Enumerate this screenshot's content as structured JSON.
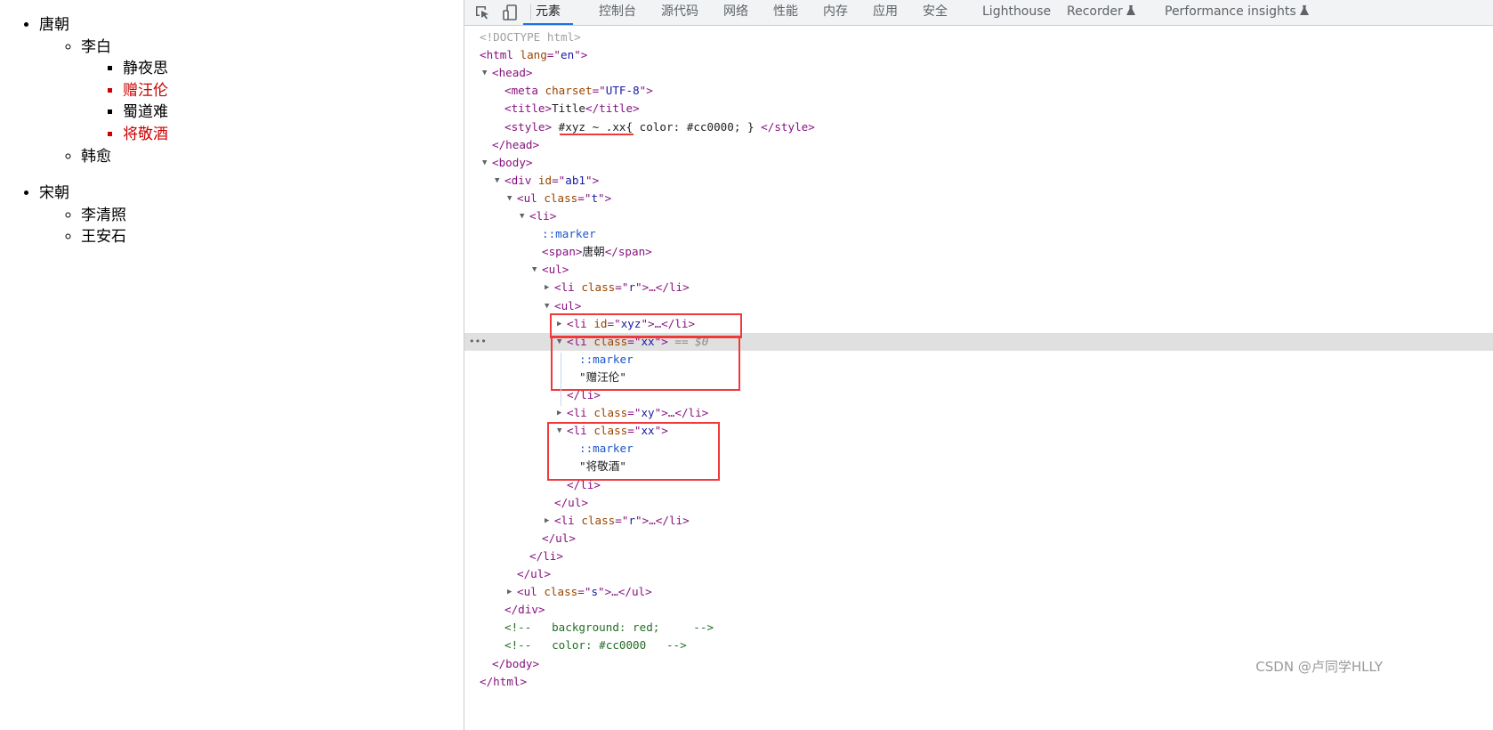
{
  "page": {
    "dynasties": [
      {
        "name": "唐朝",
        "poets": [
          {
            "name": "李白",
            "poems": [
              {
                "title": "静夜思",
                "red": false
              },
              {
                "title": "赠汪伦",
                "red": true
              },
              {
                "title": "蜀道难",
                "red": false
              },
              {
                "title": "将敬酒",
                "red": true
              }
            ]
          },
          {
            "name": "韩愈",
            "poems": []
          }
        ]
      },
      {
        "name": "宋朝",
        "poets": [
          {
            "name": "李清照",
            "poems": []
          },
          {
            "name": "王安石",
            "poems": []
          }
        ]
      }
    ]
  },
  "devtools": {
    "tabs": [
      {
        "label": "元素",
        "active": true
      },
      {
        "label": "控制台"
      },
      {
        "label": "源代码"
      },
      {
        "label": "网络"
      },
      {
        "label": "性能"
      },
      {
        "label": "内存"
      },
      {
        "label": "应用"
      },
      {
        "label": "安全"
      },
      {
        "label": "Lighthouse"
      },
      {
        "label": "Recorder",
        "icon": "flask-icon"
      },
      {
        "label": "Performance insights",
        "icon": "flask-icon"
      }
    ],
    "toolbar_icons": [
      "inspect-element-icon",
      "device-toolbar-icon"
    ],
    "accent": "#1a73e8",
    "highlight_color": "#f03a3a",
    "lines": [
      {
        "lv": 0,
        "t": [
          [
            "dt",
            "<!DOCTYPE html>"
          ]
        ]
      },
      {
        "lv": 0,
        "t": [
          [
            "tag",
            "<html "
          ],
          [
            "an",
            "lang"
          ],
          [
            "tag",
            "=\""
          ],
          [
            "av",
            "en"
          ],
          [
            "tag",
            "\">"
          ]
        ]
      },
      {
        "lv": 1,
        "open": true,
        "t": [
          [
            "tag",
            "<head>"
          ]
        ]
      },
      {
        "lv": 2,
        "t": [
          [
            "tag",
            "<meta "
          ],
          [
            "an",
            "charset"
          ],
          [
            "tag",
            "=\""
          ],
          [
            "av",
            "UTF-8"
          ],
          [
            "tag",
            "\">"
          ]
        ]
      },
      {
        "lv": 2,
        "t": [
          [
            "tag",
            "<title>"
          ],
          [
            "tx",
            "Title"
          ],
          [
            "tag",
            "</title>"
          ]
        ]
      },
      {
        "lv": 2,
        "t": [
          [
            "tag",
            "<style> "
          ],
          [
            "tx",
            "#xyz ~ .xx"
          ],
          [
            "tx",
            "{ color: #cc0000; } "
          ],
          [
            "tag",
            "</style>"
          ]
        ]
      },
      {
        "lv": 1,
        "t": [
          [
            "tag",
            "</head>"
          ]
        ]
      },
      {
        "lv": 1,
        "open": true,
        "t": [
          [
            "tag",
            "<body>"
          ]
        ]
      },
      {
        "lv": 2,
        "open": true,
        "t": [
          [
            "tag",
            "<div "
          ],
          [
            "an",
            "id"
          ],
          [
            "tag",
            "=\""
          ],
          [
            "av",
            "ab1"
          ],
          [
            "tag",
            "\">"
          ]
        ]
      },
      {
        "lv": 3,
        "open": true,
        "t": [
          [
            "tag",
            "<ul "
          ],
          [
            "an",
            "class"
          ],
          [
            "tag",
            "=\""
          ],
          [
            "av",
            "t"
          ],
          [
            "tag",
            "\">"
          ]
        ]
      },
      {
        "lv": 4,
        "open": true,
        "t": [
          [
            "tag",
            "<li>"
          ]
        ]
      },
      {
        "lv": 5,
        "t": [
          [
            "ps",
            "::marker"
          ]
        ]
      },
      {
        "lv": 5,
        "t": [
          [
            "tag",
            "<span>"
          ],
          [
            "tx",
            "唐朝"
          ],
          [
            "tag",
            "</span>"
          ]
        ]
      },
      {
        "lv": 5,
        "open": true,
        "t": [
          [
            "tag",
            "<ul>"
          ]
        ]
      },
      {
        "lv": 6,
        "open": false,
        "t": [
          [
            "tag",
            "<li "
          ],
          [
            "an",
            "class"
          ],
          [
            "tag",
            "=\""
          ],
          [
            "av",
            "r"
          ],
          [
            "tag",
            "\">…</li>"
          ]
        ]
      },
      {
        "lv": 6,
        "open": true,
        "t": [
          [
            "tag",
            "<ul>"
          ]
        ]
      },
      {
        "lv": 7,
        "open": false,
        "t": [
          [
            "tag",
            "<li "
          ],
          [
            "an",
            "id"
          ],
          [
            "tag",
            "=\""
          ],
          [
            "av",
            "xyz"
          ],
          [
            "tag",
            "\">…</li>"
          ]
        ]
      },
      {
        "lv": 7,
        "open": true,
        "selected": true,
        "t": [
          [
            "tag",
            "<li "
          ],
          [
            "an",
            "class"
          ],
          [
            "tag",
            "=\""
          ],
          [
            "av",
            "xx"
          ],
          [
            "tag",
            "\">"
          ],
          [
            "sel",
            " == $0"
          ]
        ]
      },
      {
        "lv": 8,
        "t": [
          [
            "ps",
            "::marker"
          ]
        ]
      },
      {
        "lv": 8,
        "t": [
          [
            "tx",
            "\"赠汪伦\""
          ]
        ]
      },
      {
        "lv": 7,
        "t": [
          [
            "tag",
            "</li>"
          ]
        ]
      },
      {
        "lv": 7,
        "open": false,
        "t": [
          [
            "tag",
            "<li "
          ],
          [
            "an",
            "class"
          ],
          [
            "tag",
            "=\""
          ],
          [
            "av",
            "xy"
          ],
          [
            "tag",
            "\">…</li>"
          ]
        ]
      },
      {
        "lv": 7,
        "open": true,
        "t": [
          [
            "tag",
            "<li "
          ],
          [
            "an",
            "class"
          ],
          [
            "tag",
            "=\""
          ],
          [
            "av",
            "xx"
          ],
          [
            "tag",
            "\">"
          ]
        ]
      },
      {
        "lv": 8,
        "t": [
          [
            "ps",
            "::marker"
          ]
        ]
      },
      {
        "lv": 8,
        "t": [
          [
            "tx",
            "\"将敬酒\""
          ]
        ]
      },
      {
        "lv": 7,
        "t": [
          [
            "tag",
            "</li>"
          ]
        ]
      },
      {
        "lv": 6,
        "t": [
          [
            "tag",
            "</ul>"
          ]
        ]
      },
      {
        "lv": 6,
        "open": false,
        "t": [
          [
            "tag",
            "<li "
          ],
          [
            "an",
            "class"
          ],
          [
            "tag",
            "=\""
          ],
          [
            "av",
            "r"
          ],
          [
            "tag",
            "\">…</li>"
          ]
        ]
      },
      {
        "lv": 5,
        "t": [
          [
            "tag",
            "</ul>"
          ]
        ]
      },
      {
        "lv": 4,
        "t": [
          [
            "tag",
            "</li>"
          ]
        ]
      },
      {
        "lv": 3,
        "t": [
          [
            "tag",
            "</ul>"
          ]
        ]
      },
      {
        "lv": 3,
        "open": false,
        "t": [
          [
            "tag",
            "<ul "
          ],
          [
            "an",
            "class"
          ],
          [
            "tag",
            "=\""
          ],
          [
            "av",
            "s"
          ],
          [
            "tag",
            "\">…</ul>"
          ]
        ]
      },
      {
        "lv": 2,
        "t": [
          [
            "tag",
            "</div>"
          ]
        ]
      },
      {
        "lv": 2,
        "t": [
          [
            "cm",
            "<!--   background: red;     -->"
          ]
        ]
      },
      {
        "lv": 2,
        "t": [
          [
            "cm",
            "<!--   color: #cc0000   -->"
          ]
        ]
      },
      {
        "lv": 1,
        "t": [
          [
            "tag",
            "</body>"
          ]
        ]
      },
      {
        "lv": 0,
        "t": [
          [
            "tag",
            "</html>"
          ]
        ]
      }
    ]
  },
  "watermark": "CSDN @卢同学HLLY"
}
